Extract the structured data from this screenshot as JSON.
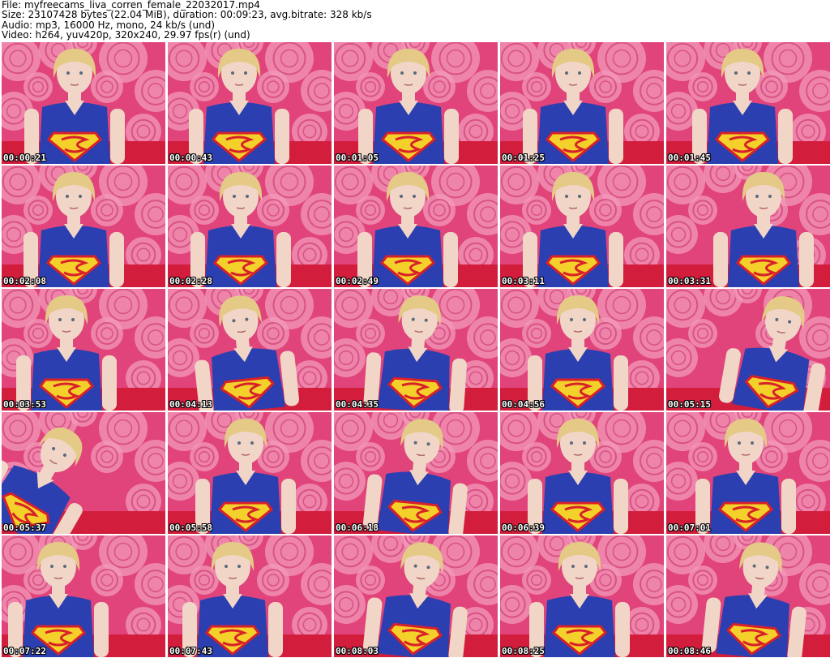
{
  "header": {
    "file": "File: myfreecams_liva_corren_female_22032017.mp4",
    "size": "Size: 23107428 bytes (22.04 MiB), duration: 00:09:23, avg.bitrate: 328 kb/s",
    "audio": "Audio: mp3, 16000 Hz, mono, 24 kb/s (und)",
    "video": "Video: h264, yuv420p, 320x240, 29.97 fps(r) (und)"
  },
  "colors": {
    "background": "#e0447a",
    "rose_light": "#f39abb",
    "rose_dark": "#c92a66",
    "shirt": "#2b3fb0",
    "emblem_red": "#d8202a",
    "emblem_yellow": "#f4d12a",
    "skin": "#f1d6c8",
    "hair": "#e4c987",
    "bed": "#d21d3c"
  },
  "thumbnails": [
    {
      "timestamp": "00:00:21",
      "icon": "video-frame-thumbnail"
    },
    {
      "timestamp": "00:00:43",
      "icon": "video-frame-thumbnail"
    },
    {
      "timestamp": "00:01:05",
      "icon": "video-frame-thumbnail"
    },
    {
      "timestamp": "00:01:25",
      "icon": "video-frame-thumbnail"
    },
    {
      "timestamp": "00:01:45",
      "icon": "video-frame-thumbnail"
    },
    {
      "timestamp": "00:02:08",
      "icon": "video-frame-thumbnail"
    },
    {
      "timestamp": "00:02:28",
      "icon": "video-frame-thumbnail"
    },
    {
      "timestamp": "00:02:49",
      "icon": "video-frame-thumbnail"
    },
    {
      "timestamp": "00:03:11",
      "icon": "video-frame-thumbnail"
    },
    {
      "timestamp": "00:03:31",
      "icon": "video-frame-thumbnail"
    },
    {
      "timestamp": "00:03:53",
      "icon": "video-frame-thumbnail"
    },
    {
      "timestamp": "00:04:13",
      "icon": "video-frame-thumbnail"
    },
    {
      "timestamp": "00:04:35",
      "icon": "video-frame-thumbnail"
    },
    {
      "timestamp": "00:04:56",
      "icon": "video-frame-thumbnail"
    },
    {
      "timestamp": "00:05:15",
      "icon": "video-frame-thumbnail"
    },
    {
      "timestamp": "00:05:37",
      "icon": "video-frame-thumbnail"
    },
    {
      "timestamp": "00:05:58",
      "icon": "video-frame-thumbnail"
    },
    {
      "timestamp": "00:06:18",
      "icon": "video-frame-thumbnail"
    },
    {
      "timestamp": "00:06:39",
      "icon": "video-frame-thumbnail"
    },
    {
      "timestamp": "00:07:01",
      "icon": "video-frame-thumbnail"
    },
    {
      "timestamp": "00:07:22",
      "icon": "video-frame-thumbnail"
    },
    {
      "timestamp": "00:07:43",
      "icon": "video-frame-thumbnail"
    },
    {
      "timestamp": "00:08:03",
      "icon": "video-frame-thumbnail"
    },
    {
      "timestamp": "00:08:25",
      "icon": "video-frame-thumbnail"
    },
    {
      "timestamp": "00:08:46",
      "icon": "video-frame-thumbnail"
    }
  ]
}
